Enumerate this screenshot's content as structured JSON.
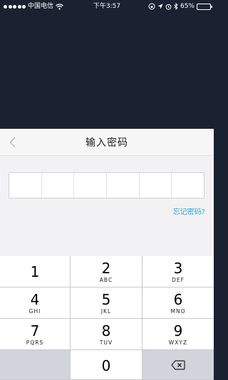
{
  "status_bar": {
    "carrier": "中国电信",
    "time": "下午3:57",
    "battery_percent": "65%",
    "battery_level": 0.65,
    "icons": [
      "signal-dots",
      "wifi-icon",
      "lock-rotation-icon",
      "location-icon",
      "alarm-icon",
      "bluetooth-icon",
      "battery-icon"
    ]
  },
  "sheet": {
    "title": "输入密码",
    "back_icon": "chevron-left-icon",
    "pin_length": 6,
    "forgot_link": "忘记密码?"
  },
  "keypad": {
    "keys": [
      {
        "num": "1",
        "letters": ""
      },
      {
        "num": "2",
        "letters": "ABC"
      },
      {
        "num": "3",
        "letters": "DEF"
      },
      {
        "num": "4",
        "letters": "GHI"
      },
      {
        "num": "5",
        "letters": "JKL"
      },
      {
        "num": "6",
        "letters": "MNO"
      },
      {
        "num": "7",
        "letters": "PQRS"
      },
      {
        "num": "8",
        "letters": "TUV"
      },
      {
        "num": "9",
        "letters": "WXYZ"
      },
      {
        "num": "0",
        "letters": ""
      }
    ],
    "delete_icon": "backspace-icon"
  },
  "colors": {
    "backdrop": "#1a2130",
    "link": "#2aa4dd",
    "sheet_bg": "#f2f2f4",
    "key_bg": "#ffffff",
    "function_key_bg": "#d1d4da"
  }
}
